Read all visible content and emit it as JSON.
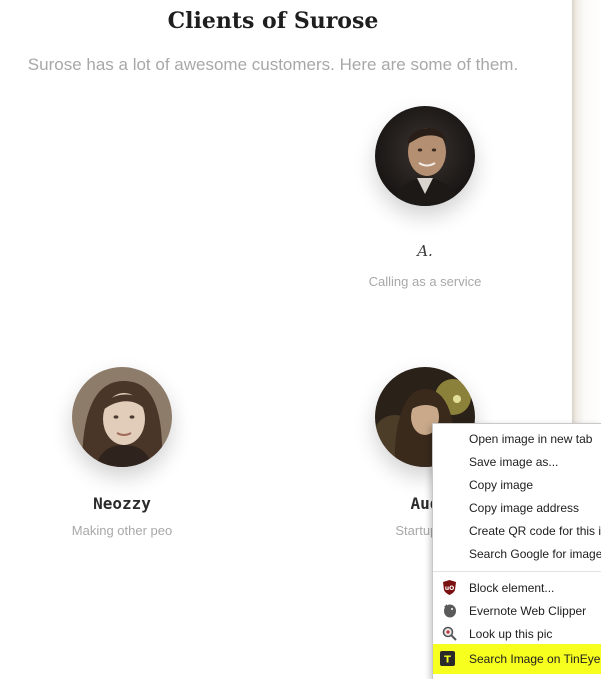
{
  "section": {
    "title": "Clients of Surose",
    "subtitle": "Surose has a lot of awesome customers. Here are some of them."
  },
  "clients": [
    {
      "name": "",
      "signature": "A.",
      "role": "Calling as a service"
    },
    {
      "name": "Neozzy",
      "role": "Making other peo"
    },
    {
      "name": "Aud",
      "role": "Startup as"
    }
  ],
  "context_menu": {
    "items": [
      "Open image in new tab",
      "Save image as...",
      "Copy image",
      "Copy image address",
      "Create QR code for this i",
      "Search Google for image"
    ],
    "extensions": [
      {
        "label": "Block element...",
        "icon": "ublock-shield-icon"
      },
      {
        "label": "Evernote Web Clipper",
        "icon": "evernote-elephant-icon"
      },
      {
        "label": "Look up this pic",
        "icon": "magnifier-lookup-icon"
      },
      {
        "label": "Search Image on TinEye",
        "icon": "tineye-t-icon"
      }
    ],
    "highlight_color": "#f7ff1e"
  }
}
